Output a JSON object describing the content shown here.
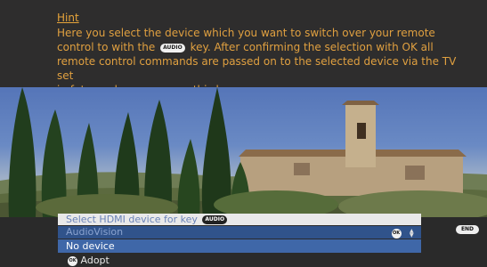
{
  "hint": {
    "title": "Hint",
    "line1": "Here you select the device which you want to switch over your remote",
    "line2a": "control to with the",
    "key_audio": "AUDIO",
    "line2b": "key. After confirming the selection with OK all",
    "line3": "remote control commands are passed on to the selected device via the TV set",
    "line4": "in future when you press this key."
  },
  "menu": {
    "header_label": "Select HDMI device for key",
    "header_key": "AUDIO",
    "current_value": "AudioVision",
    "selected_option": "No device",
    "footer_ok": "OK",
    "footer_label": "Adopt",
    "ok_icon": "OK"
  },
  "remote_keys": {
    "end": "END"
  },
  "colors": {
    "hint_text": "#e0a040",
    "menu_selected": "#3f67a8",
    "menu_current": "#30538b",
    "menu_header": "#e9e9e9"
  }
}
